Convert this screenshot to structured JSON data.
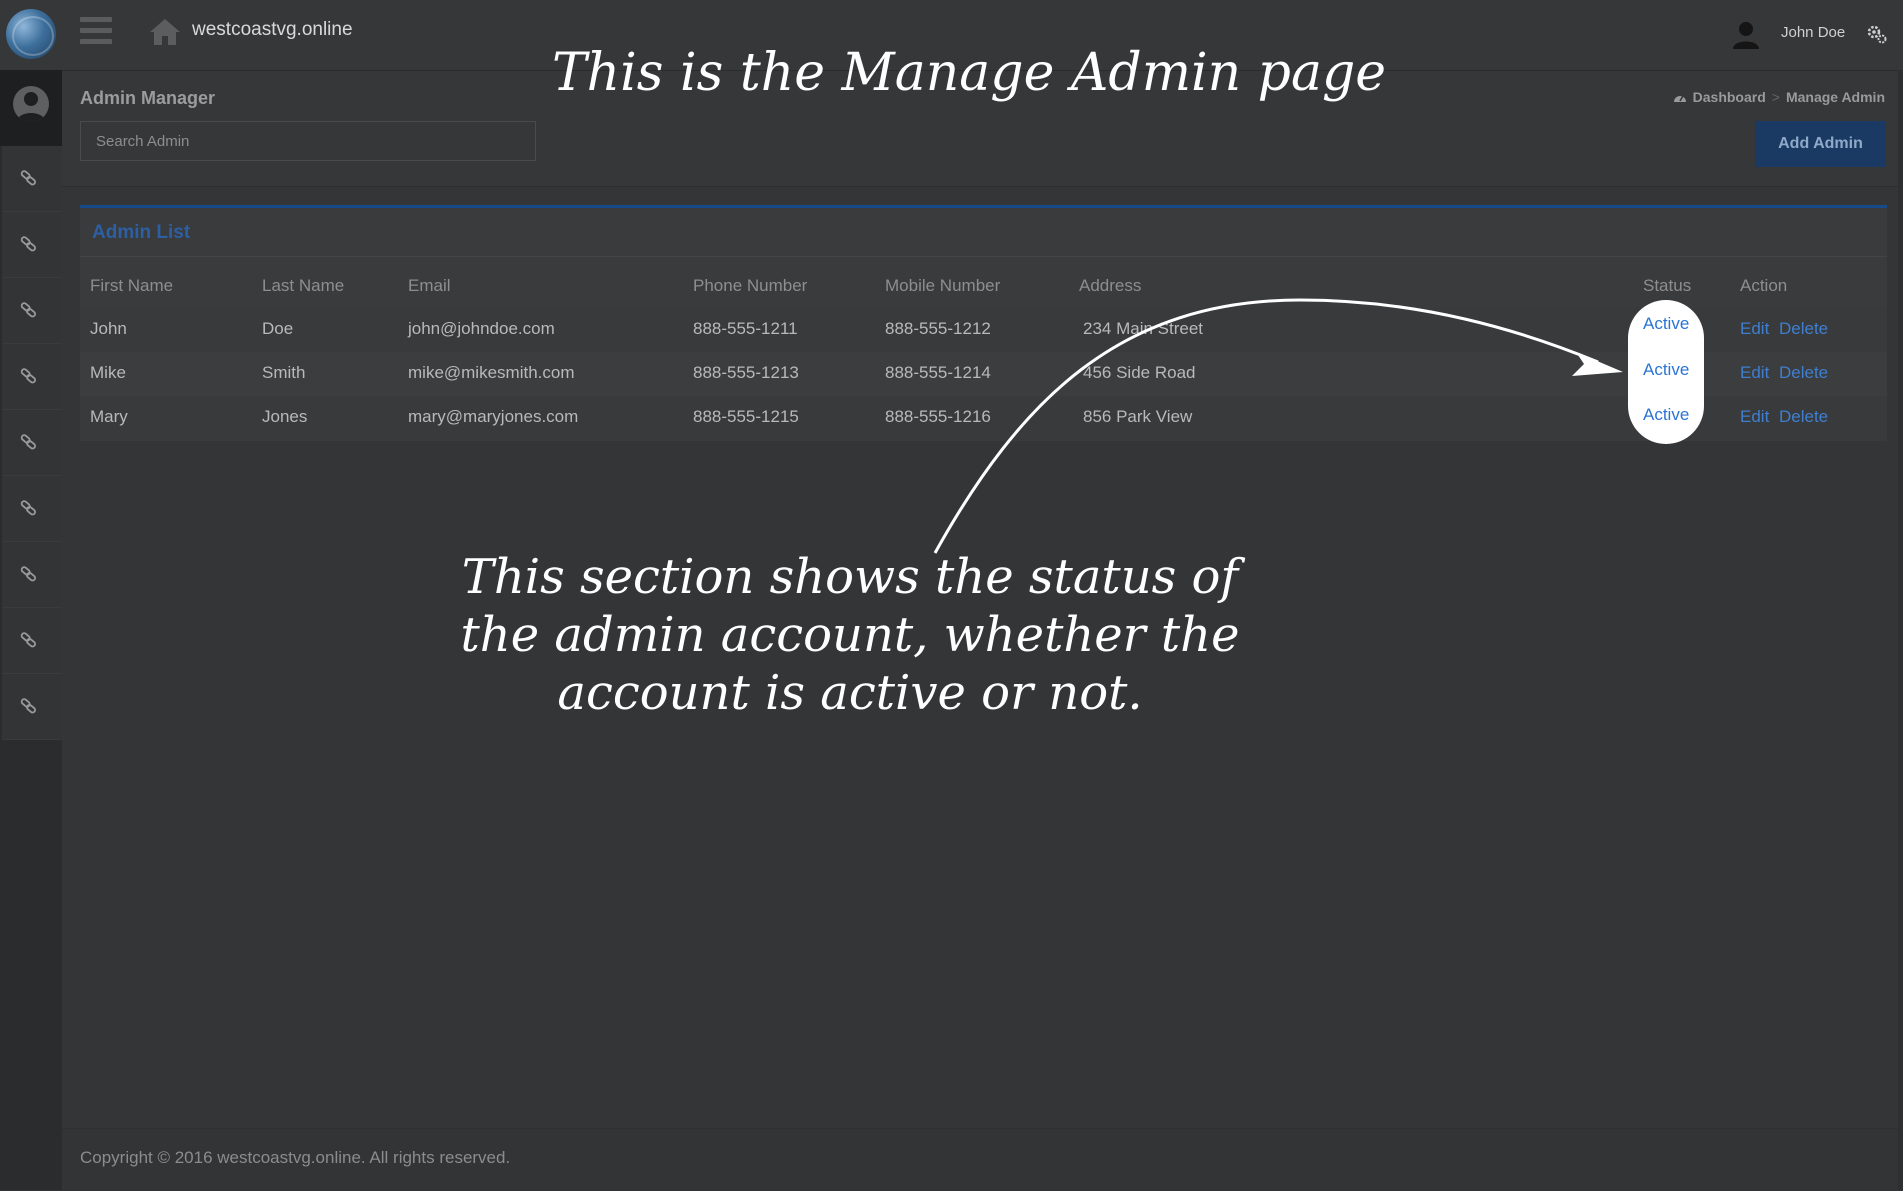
{
  "header": {
    "site_name": "westcoastvg.online",
    "user_name": "John Doe"
  },
  "page": {
    "heading": "Admin Manager",
    "search_placeholder": "Search Admin",
    "add_button": "Add Admin",
    "breadcrumb": {
      "dashboard": "Dashboard",
      "current": "Manage Admin"
    }
  },
  "panel": {
    "title": "Admin List",
    "columns": [
      "First Name",
      "Last Name",
      "Email",
      "Phone Number",
      "Mobile Number",
      "Address",
      "Status",
      "Action"
    ],
    "rows": [
      {
        "first": "John",
        "last": "Doe",
        "email": "john@johndoe.com",
        "phone": "888-555-1211",
        "mobile": "888-555-1212",
        "address": "234 Main Street",
        "status": "Active",
        "edit": "Edit",
        "delete": "Delete"
      },
      {
        "first": "Mike",
        "last": "Smith",
        "email": "mike@mikesmith.com",
        "phone": "888-555-1213",
        "mobile": "888-555-1214",
        "address": "456 Side Road",
        "status": "Active",
        "edit": "Edit",
        "delete": "Delete"
      },
      {
        "first": "Mary",
        "last": "Jones",
        "email": "mary@maryjones.com",
        "phone": "888-555-1215",
        "mobile": "888-555-1216",
        "address": "856 Park View",
        "status": "Active",
        "edit": "Edit",
        "delete": "Delete"
      }
    ]
  },
  "annotations": {
    "title": "This is the Manage Admin page",
    "body": "This section shows the status of the admin account, whether the account is active or not."
  },
  "footer": {
    "copyright": "Copyright © 2016 westcoastvg.online. All rights reserved."
  },
  "colors": {
    "accent": "#174a8a",
    "link": "#3f7fd0",
    "background": "#343537"
  },
  "icons": {
    "sidebar": [
      "link-icon",
      "link-icon",
      "link-icon",
      "link-icon",
      "link-icon",
      "link-icon",
      "link-icon",
      "link-icon",
      "link-icon"
    ]
  }
}
